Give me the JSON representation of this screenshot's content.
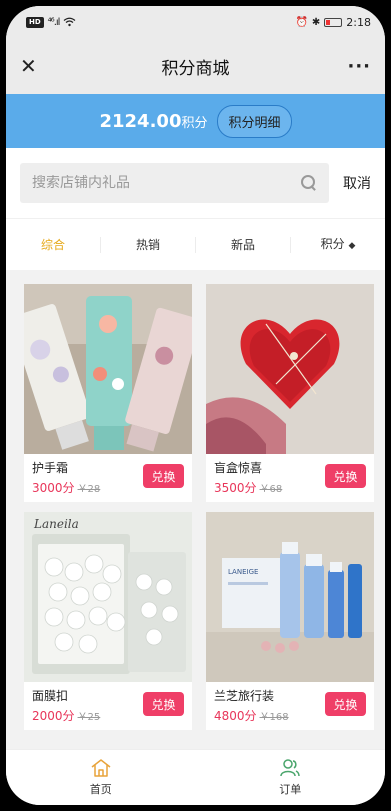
{
  "status": {
    "signal": "⁴⁶.ıl",
    "time": "2:18",
    "alarm": "⏰",
    "bt": "✱"
  },
  "nav": {
    "title": "积分商城",
    "close": "✕",
    "more": "···"
  },
  "points": {
    "value": "2124.00",
    "unit": "积分",
    "detail_label": "积分明细"
  },
  "search": {
    "placeholder": "搜索店铺内礼品",
    "cancel_label": "取消"
  },
  "tabs": [
    {
      "label": "综合"
    },
    {
      "label": "热销"
    },
    {
      "label": "新品"
    },
    {
      "label": "积分"
    }
  ],
  "products": [
    {
      "name": "护手霜",
      "points": "3000分",
      "orig_price": "￥28",
      "button": "兑换"
    },
    {
      "name": "盲盒惊喜",
      "points": "3500分",
      "orig_price": "￥68",
      "button": "兑换"
    },
    {
      "name": "面膜扣",
      "points": "2000分",
      "orig_price": "￥25",
      "button": "兑换"
    },
    {
      "name": "兰芝旅行装",
      "points": "4800分",
      "orig_price": "￥168",
      "button": "兑换"
    }
  ],
  "bottom_nav": [
    {
      "label": "首页"
    },
    {
      "label": "订单"
    }
  ],
  "colors": {
    "accent_blue": "#5aabea",
    "tab_active": "#e6a817",
    "price_red": "#e8365a",
    "button_red": "#ef3e67",
    "nav_icon_orange": "#e8a33a",
    "nav_icon_green": "#4aa56c"
  }
}
